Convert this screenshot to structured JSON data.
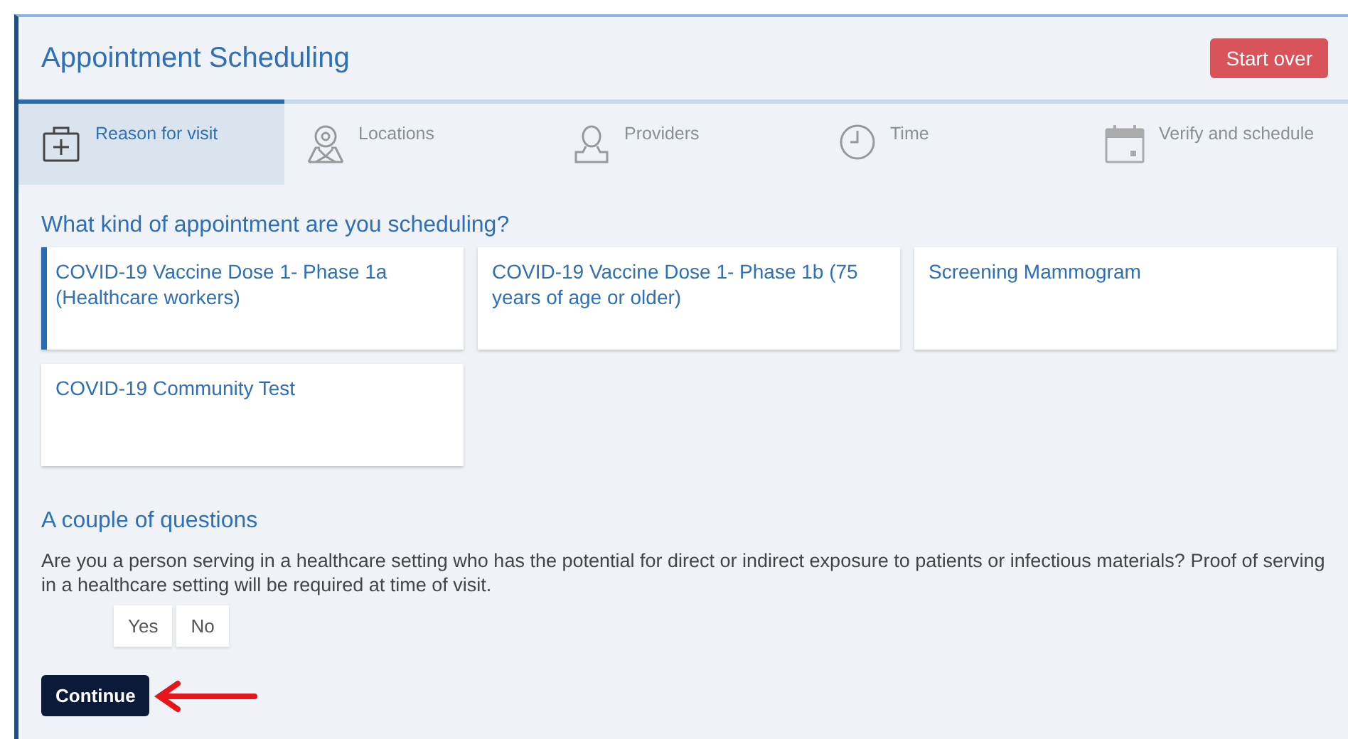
{
  "header": {
    "title": "Appointment Scheduling",
    "start_over": "Start over"
  },
  "steps": [
    {
      "label": "Reason for visit",
      "kind": "medkit",
      "selected": true
    },
    {
      "label": "Locations",
      "kind": "map",
      "selected": false
    },
    {
      "label": "Providers",
      "kind": "person",
      "selected": false
    },
    {
      "label": "Time",
      "kind": "clock",
      "selected": false
    },
    {
      "label": "Verify and schedule",
      "kind": "calendar",
      "selected": false
    }
  ],
  "appointment_types": {
    "heading": "What kind of appointment are you scheduling?",
    "options": [
      {
        "label": "COVID-19 Vaccine Dose 1- Phase 1a (Healthcare workers)",
        "selected": true
      },
      {
        "label": "COVID-19 Vaccine Dose 1- Phase 1b (75 years of age or older)",
        "selected": false
      },
      {
        "label": "Screening Mammogram",
        "selected": false
      },
      {
        "label": "COVID-19 Community Test",
        "selected": false
      }
    ]
  },
  "questions": {
    "heading": "A couple of questions",
    "text": "Are you a person serving in a healthcare setting who has the potential for direct or indirect exposure to patients or infectious materials? Proof of serving in a healthcare setting will be required at time of visit.",
    "answers": [
      {
        "label": "Yes",
        "selected": false
      },
      {
        "label": "No",
        "selected": false
      }
    ]
  },
  "continue_button": "Continue"
}
